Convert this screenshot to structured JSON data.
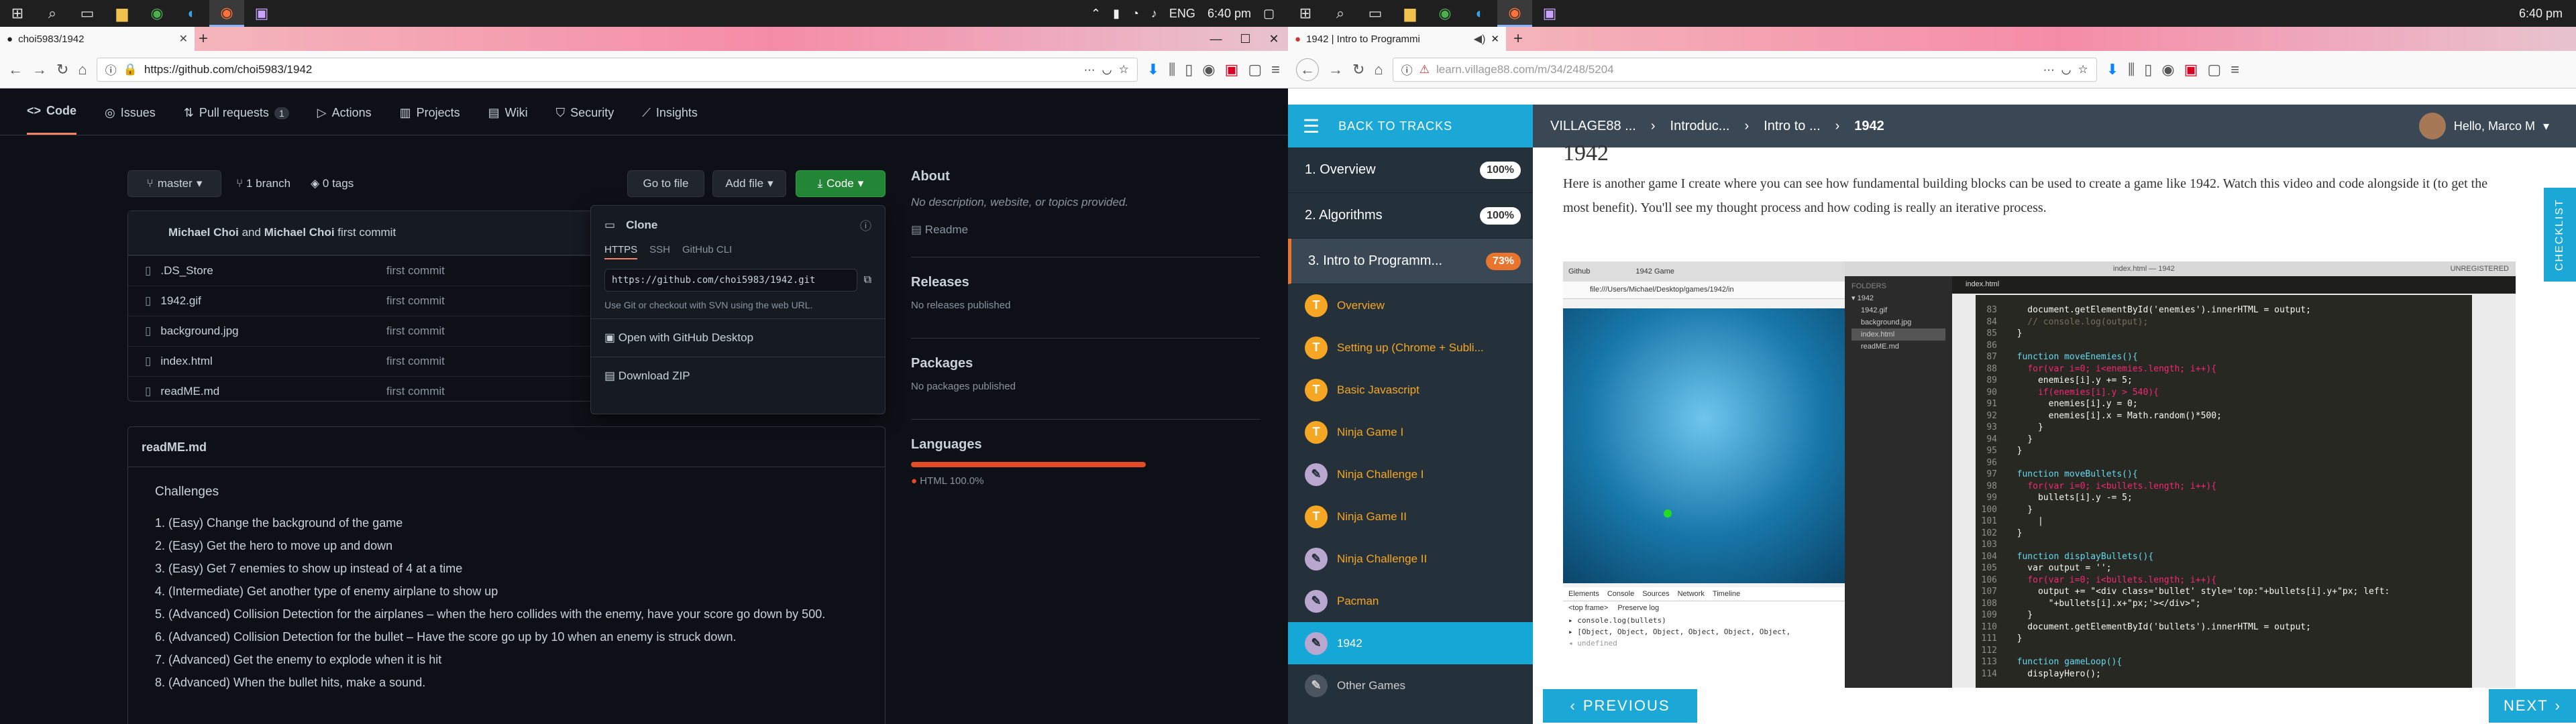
{
  "left": {
    "taskbar": {
      "time": "6:40 pm",
      "lang": "ENG"
    },
    "tab": {
      "title": "choi5983/1942"
    },
    "url": "https://github.com/choi5983/1942",
    "repo_tabs": [
      {
        "label": "Code"
      },
      {
        "label": "Issues"
      },
      {
        "label": "Pull requests",
        "count": "1"
      },
      {
        "label": "Actions"
      },
      {
        "label": "Projects"
      },
      {
        "label": "Wiki"
      },
      {
        "label": "Security"
      },
      {
        "label": "Insights"
      }
    ],
    "branch": "master",
    "branches": "1 branch",
    "tags": "0 tags",
    "go_to_file": "Go to file",
    "add_file": "Add file",
    "code_btn": "Code",
    "commit": {
      "authors_a": "Michael Choi",
      "and": "and",
      "authors_b": "Michael Choi",
      "msg": "first commit"
    },
    "files": [
      {
        "name": ".DS_Store",
        "msg": "first commit"
      },
      {
        "name": "1942.gif",
        "msg": "first commit"
      },
      {
        "name": "background.jpg",
        "msg": "first commit"
      },
      {
        "name": "index.html",
        "msg": "first commit"
      },
      {
        "name": "readME.md",
        "msg": "first commit"
      }
    ],
    "readme": {
      "title": "readME.md",
      "heading": "Challenges",
      "items": [
        "(Easy) Change the background of the game",
        "(Easy) Get the hero to move up and down",
        "(Easy) Get 7 enemies to show up instead of 4 at a time",
        "(Intermediate) Get another type of enemy airplane to show up",
        "(Advanced) Collision Detection for the airplanes – when the hero collides with the enemy, have your score go down by 500.",
        "(Advanced) Collision Detection for the bullet – Have the score go up by 10 when an enemy is struck down.",
        "(Advanced) Get the enemy to explode when it is hit",
        "(Advanced) When the bullet hits, make a sound."
      ]
    },
    "about": {
      "title": "About",
      "desc": "No description, website, or topics provided.",
      "readme": "Readme"
    },
    "releases": {
      "title": "Releases",
      "desc": "No releases published"
    },
    "packages": {
      "title": "Packages",
      "desc": "No packages published"
    },
    "languages": {
      "title": "Languages",
      "lang": "HTML",
      "pct": "100.0%",
      "color": "#e34c26"
    },
    "clone": {
      "title": "Clone",
      "tabs": [
        "HTTPS",
        "SSH",
        "GitHub CLI"
      ],
      "url": "https://github.com/choi5983/1942.git",
      "hint": "Use Git or checkout with SVN using the web URL.",
      "desktop": "Open with GitHub Desktop",
      "zip": "Download ZIP"
    }
  },
  "right": {
    "time": "6:40 pm",
    "tab": {
      "title": "1942 | Intro to Programmi"
    },
    "url_host": "learn.village88.com",
    "url_path": "/m/34/248/5204",
    "back_to_tracks": "BACK TO TRACKS",
    "crumbs": [
      "VILLAGE88 ...",
      "Introduc...",
      "Intro to ...",
      "1942"
    ],
    "user": "Hello, Marco M",
    "sections": [
      {
        "label": "1. Overview",
        "pct": "100%"
      },
      {
        "label": "2. Algorithms",
        "pct": "100%"
      },
      {
        "label": "3. Intro to Programm...",
        "pct": "73%"
      }
    ],
    "lessons": [
      {
        "label": "Overview",
        "icon": "T"
      },
      {
        "label": "Setting up (Chrome + Subli...",
        "icon": "T"
      },
      {
        "label": "Basic Javascript",
        "icon": "T"
      },
      {
        "label": "Ninja Game I",
        "icon": "T"
      },
      {
        "label": "Ninja Challenge I",
        "icon": "✎"
      },
      {
        "label": "Ninja Game II",
        "icon": "T"
      },
      {
        "label": "Ninja Challenge II",
        "icon": "✎"
      },
      {
        "label": "Pacman",
        "icon": "✎"
      },
      {
        "label": "1942",
        "icon": "✎"
      },
      {
        "label": "Other Games",
        "icon": "✎"
      }
    ],
    "heading": "1942",
    "paragraph": "Here is another game I create where you can see how fundamental building blocks can be used to create a game like 1942.  Watch this video and code alongside it (to get the most benefit).  You'll see my thought process and how coding is really an iterative process.",
    "checklist": "CHECKLIST",
    "prev": "PREVIOUS",
    "next": "NEXT",
    "video": {
      "tab1": "Github",
      "tab2": "1942 Game",
      "url": "file:///Users/Michael/Desktop/games/1942/in",
      "tab3": "index.html — 1942",
      "unreg": "UNREGISTERED",
      "folders": "FOLDERS",
      "tree": [
        "▾ 1942",
        "1942.gif",
        "background.jpg",
        "index.html",
        "readME.md"
      ],
      "editor_tab": "index.html",
      "devtools": [
        "Elements",
        "Console",
        "Sources",
        "Network",
        "Timeline"
      ],
      "console": [
        "▸ console.log(bullets)",
        "▸ [Object, Object, Object, Object, Object, Object,",
        "◂ undefined"
      ],
      "frame": "<top frame>",
      "preserve": "Preserve log"
    },
    "code_lines": [
      {
        "n": "83",
        "t": "    document.getElementById('enemies').innerHTML = output;"
      },
      {
        "n": "84",
        "t": "    // console.log(output);"
      },
      {
        "n": "85",
        "t": "  }"
      },
      {
        "n": "86",
        "t": ""
      },
      {
        "n": "87",
        "t": "  function moveEnemies(){"
      },
      {
        "n": "88",
        "t": "    for(var i=0; i<enemies.length; i++){"
      },
      {
        "n": "89",
        "t": "      enemies[i].y += 5;"
      },
      {
        "n": "90",
        "t": "      if(enemies[i].y > 540){"
      },
      {
        "n": "91",
        "t": "        enemies[i].y = 0;"
      },
      {
        "n": "92",
        "t": "        enemies[i].x = Math.random()*500;"
      },
      {
        "n": "93",
        "t": "      }"
      },
      {
        "n": "94",
        "t": "    }"
      },
      {
        "n": "95",
        "t": "  }"
      },
      {
        "n": "96",
        "t": ""
      },
      {
        "n": "97",
        "t": "  function moveBullets(){"
      },
      {
        "n": "98",
        "t": "    for(var i=0; i<bullets.length; i++){"
      },
      {
        "n": "99",
        "t": "      bullets[i].y -= 5;"
      },
      {
        "n": "100",
        "t": "    }"
      },
      {
        "n": "101",
        "t": "      |"
      },
      {
        "n": "102",
        "t": "  }"
      },
      {
        "n": "103",
        "t": ""
      },
      {
        "n": "104",
        "t": "  function displayBullets(){"
      },
      {
        "n": "105",
        "t": "    var output = '';"
      },
      {
        "n": "106",
        "t": "    for(var i=0; i<bullets.length; i++){"
      },
      {
        "n": "107",
        "t": "      output += \"<div class='bullet' style='top:\"+bullets[i].y+\"px; left:"
      },
      {
        "n": "108",
        "t": "        \"+bullets[i].x+\"px;'></div>\";"
      },
      {
        "n": "109",
        "t": "    }"
      },
      {
        "n": "110",
        "t": "    document.getElementById('bullets').innerHTML = output;"
      },
      {
        "n": "111",
        "t": "  }"
      },
      {
        "n": "112",
        "t": ""
      },
      {
        "n": "113",
        "t": "  function gameLoop(){"
      },
      {
        "n": "114",
        "t": "    displayHero();"
      }
    ]
  }
}
